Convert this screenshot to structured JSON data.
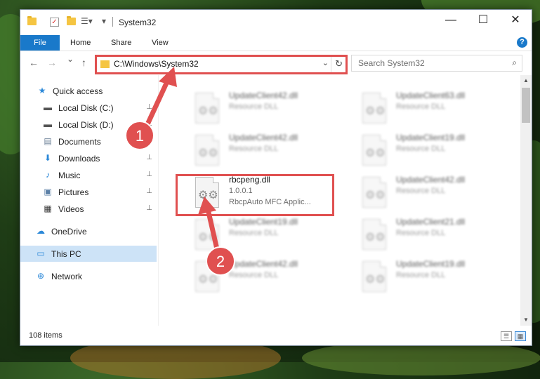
{
  "window": {
    "title": "System32",
    "controls": {
      "minimize": "—",
      "maximize": "☐",
      "close": "✕"
    }
  },
  "ribbon": {
    "tabs": [
      "File",
      "Home",
      "Share",
      "View"
    ],
    "help": "?"
  },
  "navigation": {
    "back": "←",
    "forward": "→",
    "recent": "⌄",
    "up": "↑",
    "address": "C:\\Windows\\System32",
    "address_dropdown": "⌄",
    "refresh": "↻",
    "search_placeholder": "Search System32"
  },
  "sidebar": {
    "items": [
      {
        "label": "Quick access",
        "icon": "star-icon",
        "glyph": "★",
        "color": "#2b88d8",
        "pinned": false
      },
      {
        "label": "Local Disk (C:)",
        "icon": "drive-icon",
        "glyph": "▬",
        "color": "#555555",
        "pinned": true
      },
      {
        "label": "Local Disk (D:)",
        "icon": "drive-icon",
        "glyph": "▬",
        "color": "#555555",
        "pinned": true
      },
      {
        "label": "Documents",
        "icon": "documents-icon",
        "glyph": "▤",
        "color": "#6a7f96",
        "pinned": true
      },
      {
        "label": "Downloads",
        "icon": "downloads-icon",
        "glyph": "⬇",
        "color": "#2b88d8",
        "pinned": true
      },
      {
        "label": "Music",
        "icon": "music-icon",
        "glyph": "♪",
        "color": "#2b88d8",
        "pinned": true
      },
      {
        "label": "Pictures",
        "icon": "pictures-icon",
        "glyph": "▣",
        "color": "#5b7fa6",
        "pinned": true
      },
      {
        "label": "Videos",
        "icon": "videos-icon",
        "glyph": "▦",
        "color": "#333333",
        "pinned": true
      },
      {
        "label": "OneDrive",
        "icon": "onedrive-icon",
        "glyph": "☁",
        "color": "#2b88d8",
        "pinned": false
      },
      {
        "label": "This PC",
        "icon": "pc-icon",
        "glyph": "▭",
        "color": "#2b88d8",
        "pinned": false,
        "selected": true
      },
      {
        "label": "Network",
        "icon": "network-icon",
        "glyph": "⊕",
        "color": "#2b88d8",
        "pinned": false
      }
    ],
    "pin_glyph": "📌"
  },
  "files": {
    "left": [
      {
        "name": "UpdateClient42.dll",
        "type": "Resource DLL",
        "desc": ""
      },
      {
        "name": "UpdateClient42.dll",
        "type": "Resource DLL",
        "desc": ""
      },
      {
        "name": "rbcpeng.dll",
        "type": "1.0.0.1",
        "desc": "RbcpAuto MFC Applic...",
        "highlighted": true
      },
      {
        "name": "UpdateClient19.dll",
        "type": "Resource DLL",
        "desc": ""
      },
      {
        "name": "UpdateClient42.dll",
        "type": "Resource DLL",
        "desc": ""
      }
    ],
    "right": [
      {
        "name": "UpdateClient63.dll",
        "type": "Resource DLL"
      },
      {
        "name": "UpdateClient19.dll",
        "type": "Resource DLL"
      },
      {
        "name": "UpdateClient42.dll",
        "type": "Resource DLL"
      },
      {
        "name": "UpdateClient21.dll",
        "type": "Resource DLL"
      },
      {
        "name": "UpdateClient19.dll",
        "type": "Resource DLL"
      }
    ],
    "gear_glyph": "⚙"
  },
  "status": {
    "item_count": "108 items"
  },
  "annotations": {
    "markers": [
      "1",
      "2"
    ],
    "color": "#e05050"
  },
  "colors": {
    "accent": "#1979ca",
    "selection": "#cde3f7",
    "highlight": "#e05050"
  }
}
